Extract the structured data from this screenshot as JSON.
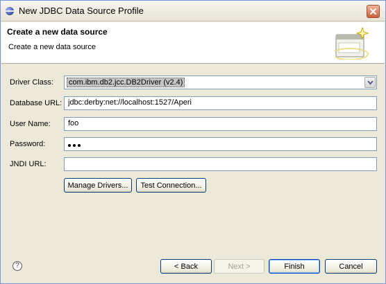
{
  "window": {
    "title": "New JDBC Data Source Profile"
  },
  "header": {
    "title": "Create a new data source",
    "subtitle": "Create a new data source"
  },
  "form": {
    "driver_class_label": "Driver Class:",
    "driver_class_value": "com.ibm.db2.jcc.DB2Driver (v2.4)",
    "database_url_label": "Database URL:",
    "database_url_value": "jdbc:derby:net://localhost:1527/Aperi",
    "user_name_label": "User Name:",
    "user_name_value": "foo",
    "password_label": "Password:",
    "password_mask_count": 3,
    "jndi_url_label": "JNDI URL:",
    "jndi_url_value": ""
  },
  "buttons": {
    "manage_drivers": "Manage Drivers...",
    "test_connection": "Test Connection...",
    "back": "< Back",
    "next": "Next >",
    "finish": "Finish",
    "cancel": "Cancel"
  },
  "icons": {
    "app": "eclipse-icon",
    "close": "close-icon",
    "wizard": "wizard-banner-icon",
    "help": "help-icon",
    "dropdown": "chevron-down-icon"
  }
}
